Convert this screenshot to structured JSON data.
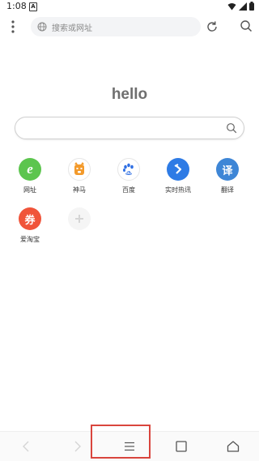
{
  "status_bar": {
    "time": "1:08",
    "notification_letter": "A"
  },
  "toolbar": {
    "url_placeholder": "搜索或网址"
  },
  "home": {
    "title": "hello"
  },
  "shortcuts": [
    {
      "label": "网址",
      "icon_text": "e",
      "color": "#5cc54e"
    },
    {
      "label": "神马",
      "icon_text": "",
      "color": "#ffffff"
    },
    {
      "label": "百度",
      "icon_text": "",
      "color": "#ffffff"
    },
    {
      "label": "实时热讯",
      "icon_text": "",
      "color": "#2e7be5"
    },
    {
      "label": "翻译",
      "icon_text": "译",
      "color": "#3e86d6"
    },
    {
      "label": "爱淘宝",
      "icon_text": "券",
      "color": "#f0543a"
    }
  ],
  "colors": {
    "highlight": "#d9453d"
  }
}
